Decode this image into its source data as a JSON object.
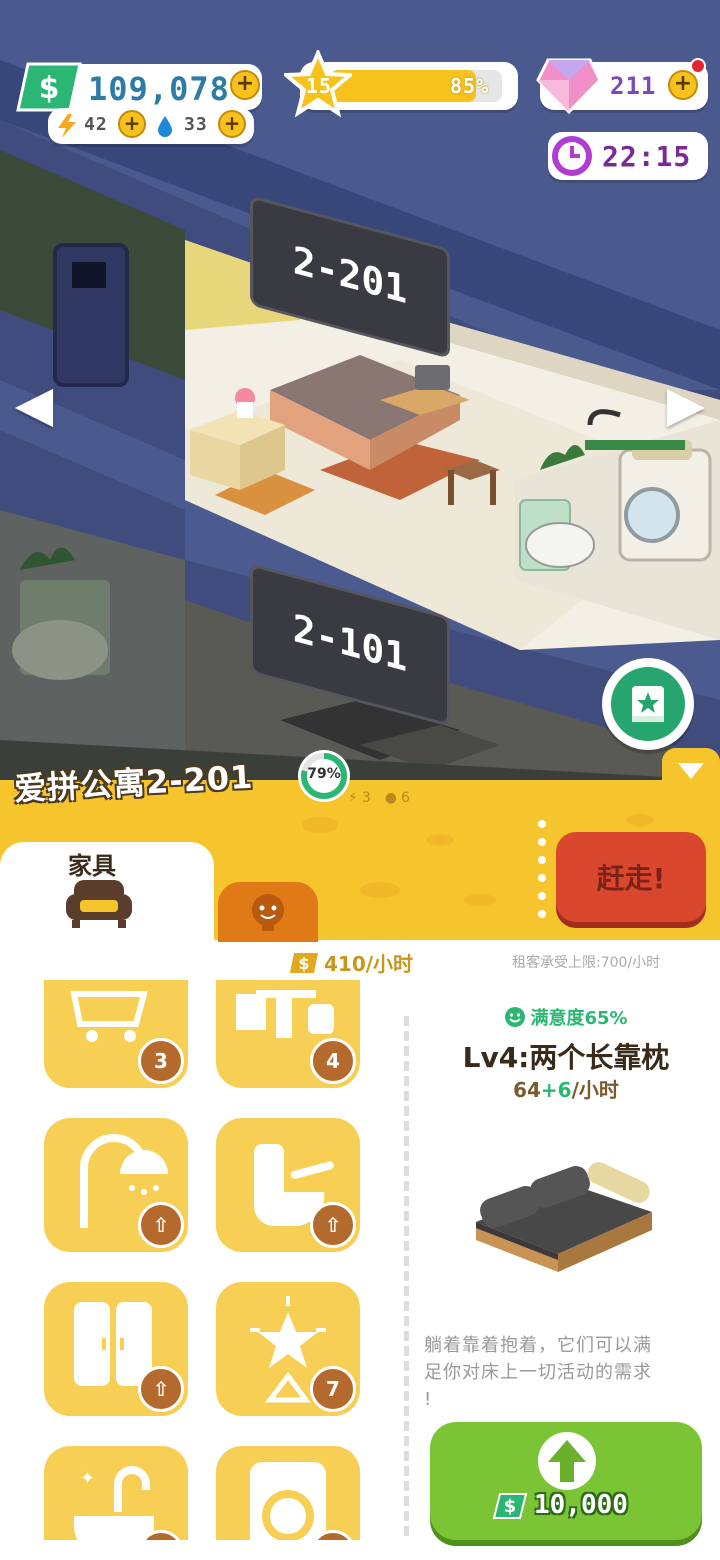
{
  "hud": {
    "money": "109,078",
    "energy": "42",
    "water": "33",
    "level": "15",
    "level_progress_text": "85%",
    "level_progress": 0.85,
    "gems": "211",
    "time": "22:15"
  },
  "rooms": {
    "upper": "2-201",
    "lower": "2-101"
  },
  "apartment": {
    "name": "爱拼公寓2-201",
    "satisfaction_ring": "79%",
    "satisfaction_value": 0.79,
    "energy_cost": "3",
    "water_cost": "6",
    "evict_button": "赶走!"
  },
  "tabs": {
    "furniture": "家具"
  },
  "income": {
    "rate": "410/小时",
    "limit": "租客承受上限:700/小时"
  },
  "tiles": [
    {
      "icon": "cart-icon",
      "badge": "3"
    },
    {
      "icon": "table-icon",
      "badge": "4"
    },
    {
      "icon": "shower-icon",
      "badge": ""
    },
    {
      "icon": "toilet-icon",
      "badge": ""
    },
    {
      "icon": "wardrobe-icon",
      "badge": ""
    },
    {
      "icon": "star-lamp-icon",
      "badge": "7"
    },
    {
      "icon": "faucet-icon",
      "badge": ""
    },
    {
      "icon": "washer-icon",
      "badge": ""
    }
  ],
  "detail": {
    "satisfaction": "满意度65%",
    "title": "Lv4:两个长靠枕",
    "income_base": "64",
    "income_bonus": "+6",
    "income_unit": "/小时",
    "description_line1": "躺着靠着抱着，它们可以满",
    "description_line2": "足你对床上一切活动的需求",
    "description_line3": "!",
    "upgrade_cost": "10,000"
  },
  "colors": {
    "panel_yellow": "#f6c52d",
    "evict_red": "#d9472e",
    "upgrade_green": "#7bc436",
    "money_green": "#2bb673",
    "gem_pink": "#f08fc8",
    "clock_purple": "#b23bd1"
  }
}
